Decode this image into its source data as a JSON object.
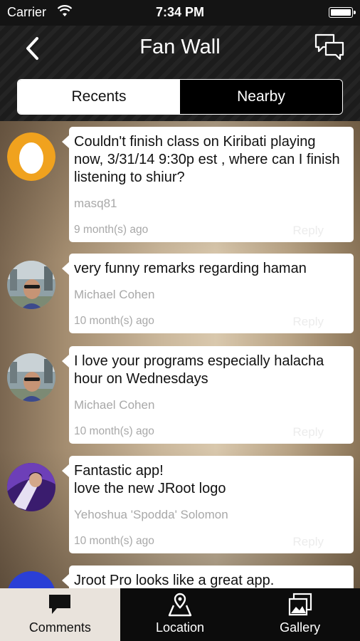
{
  "status_bar": {
    "carrier": "Carrier",
    "time": "7:34 PM"
  },
  "nav": {
    "title": "Fan Wall"
  },
  "segments": {
    "recents": "Recents",
    "nearby": "Nearby",
    "selected": "Recents"
  },
  "posts": [
    {
      "message": "Couldn't finish class on Kiribati playing now, 3/31/14 9:30p est , where can I finish listening to shiur?",
      "author": "masq81",
      "time": "9 month(s) ago",
      "reply": "Reply"
    },
    {
      "message": "very funny remarks regarding haman",
      "author": "Michael Cohen",
      "time": "10 month(s) ago",
      "reply": "Reply"
    },
    {
      "message": "I love your programs especially halacha hour on Wednesdays",
      "author": "Michael Cohen",
      "time": "10 month(s) ago",
      "reply": "Reply"
    },
    {
      "message": "Fantastic app!\nlove the new JRoot logo",
      "author": "Yehoshua 'Spodda' Solomon",
      "time": "10 month(s) ago",
      "reply": "Reply"
    },
    {
      "message": "Jroot Pro looks like a great app."
    }
  ],
  "tabs": [
    {
      "label": "Comments",
      "icon": "comment-icon",
      "active": true
    },
    {
      "label": "Location",
      "icon": "location-icon",
      "active": false
    },
    {
      "label": "Gallery",
      "icon": "gallery-icon",
      "active": false
    }
  ],
  "colors": {
    "nav_bg": "#1c1c1c",
    "active_tab_bg": "#e9e3dc",
    "egg_avatar": "#f0a21e"
  }
}
